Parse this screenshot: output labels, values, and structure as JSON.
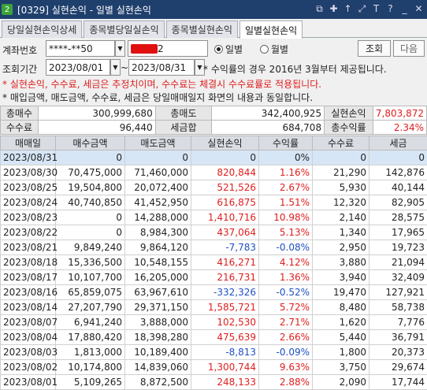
{
  "window": {
    "number": "2",
    "title": "[0329] 실현손익 - 일별 실현손익"
  },
  "title_icons": [
    "restore-icon",
    "pin-icon",
    "arrow-up-icon",
    "resize-icon",
    "font-size-icon",
    "help-icon",
    "minimize-icon",
    "close-icon"
  ],
  "tabs": [
    "당일실현손익상세",
    "종목별당일실손익",
    "종목별실현손익",
    "일별실현손익"
  ],
  "account": {
    "label": "계좌번호",
    "masked": "****-**50",
    "name_suffix": "2"
  },
  "query_button": "조회",
  "next_button": "다음",
  "period": {
    "label": "조회기간",
    "from": "2023/08/01",
    "tilde": "~",
    "to": "2023/08/31"
  },
  "radios": [
    {
      "label": "일별",
      "selected": true
    },
    {
      "label": "월별",
      "selected": false
    }
  ],
  "notices": {
    "rate_note": "* 수익률의 경우 2016년 3월부터 제공됩니다.",
    "warning": "* 실현손익, 수수료, 세금은 추정치이며, 수수료는 체결시 수수료률로 적용됩니다.",
    "info": "* 매입금액, 매도금액, 수수료, 세금은 당일매매일지 화면의 내용과 동일합니다."
  },
  "summary": {
    "total_buy_label": "총매수",
    "total_buy": "300,999,680",
    "total_sell_label": "총매도",
    "total_sell": "342,400,925",
    "realized_label": "실현손익",
    "realized": "7,803,872",
    "fee_label": "수수료",
    "fee": "96,440",
    "tax_label": "세금합",
    "tax": "684,708",
    "total_rate_label": "총수익률",
    "total_rate": "2.34%"
  },
  "columns": [
    "매매일",
    "매수금액",
    "매도금액",
    "실현손익",
    "수익률",
    "수수료",
    "세금"
  ],
  "rows": [
    {
      "date": "2023/08/31",
      "buy": "0",
      "sell": "0",
      "pl": "0",
      "rate": "0%",
      "fee": "0",
      "tax": "0",
      "sign": "zero"
    },
    {
      "date": "2023/08/30",
      "buy": "70,475,000",
      "sell": "71,460,000",
      "pl": "820,844",
      "rate": "1.16%",
      "fee": "21,290",
      "tax": "142,876",
      "sign": "pos"
    },
    {
      "date": "2023/08/25",
      "buy": "19,504,800",
      "sell": "20,072,400",
      "pl": "521,526",
      "rate": "2.67%",
      "fee": "5,930",
      "tax": "40,144",
      "sign": "pos"
    },
    {
      "date": "2023/08/24",
      "buy": "40,740,850",
      "sell": "41,452,950",
      "pl": "616,875",
      "rate": "1.51%",
      "fee": "12,320",
      "tax": "82,905",
      "sign": "pos"
    },
    {
      "date": "2023/08/23",
      "buy": "0",
      "sell": "14,288,000",
      "pl": "1,410,716",
      "rate": "10.98%",
      "fee": "2,140",
      "tax": "28,575",
      "sign": "pos"
    },
    {
      "date": "2023/08/22",
      "buy": "0",
      "sell": "8,984,300",
      "pl": "437,064",
      "rate": "5.13%",
      "fee": "1,340",
      "tax": "17,965",
      "sign": "pos"
    },
    {
      "date": "2023/08/21",
      "buy": "9,849,240",
      "sell": "9,864,120",
      "pl": "-7,783",
      "rate": "-0.08%",
      "fee": "2,950",
      "tax": "19,723",
      "sign": "neg"
    },
    {
      "date": "2023/08/18",
      "buy": "15,336,500",
      "sell": "10,548,155",
      "pl": "416,271",
      "rate": "4.12%",
      "fee": "3,880",
      "tax": "21,094",
      "sign": "pos"
    },
    {
      "date": "2023/08/17",
      "buy": "10,107,700",
      "sell": "16,205,000",
      "pl": "216,731",
      "rate": "1.36%",
      "fee": "3,940",
      "tax": "32,409",
      "sign": "pos"
    },
    {
      "date": "2023/08/16",
      "buy": "65,859,075",
      "sell": "63,967,610",
      "pl": "-332,326",
      "rate": "-0.52%",
      "fee": "19,470",
      "tax": "127,921",
      "sign": "neg"
    },
    {
      "date": "2023/08/14",
      "buy": "27,207,790",
      "sell": "29,371,150",
      "pl": "1,585,721",
      "rate": "5.72%",
      "fee": "8,480",
      "tax": "58,738",
      "sign": "pos"
    },
    {
      "date": "2023/08/07",
      "buy": "6,941,240",
      "sell": "3,888,000",
      "pl": "102,530",
      "rate": "2.71%",
      "fee": "1,620",
      "tax": "7,776",
      "sign": "pos"
    },
    {
      "date": "2023/08/04",
      "buy": "17,880,420",
      "sell": "18,398,280",
      "pl": "475,639",
      "rate": "2.66%",
      "fee": "5,440",
      "tax": "36,791",
      "sign": "pos"
    },
    {
      "date": "2023/08/03",
      "buy": "1,813,000",
      "sell": "10,189,400",
      "pl": "-8,813",
      "rate": "-0.09%",
      "fee": "1,800",
      "tax": "20,373",
      "sign": "neg"
    },
    {
      "date": "2023/08/02",
      "buy": "10,174,800",
      "sell": "14,839,060",
      "pl": "1,300,744",
      "rate": "9.63%",
      "fee": "3,750",
      "tax": "29,674",
      "sign": "pos"
    },
    {
      "date": "2023/08/01",
      "buy": "5,109,265",
      "sell": "8,872,500",
      "pl": "248,133",
      "rate": "2.88%",
      "fee": "2,090",
      "tax": "17,744",
      "sign": "pos"
    }
  ],
  "colors": {
    "positive": "#e01e1e",
    "negative": "#1f4fc4",
    "title_bg": "#1f3f6d",
    "selected_row": "#d7e6f6"
  }
}
